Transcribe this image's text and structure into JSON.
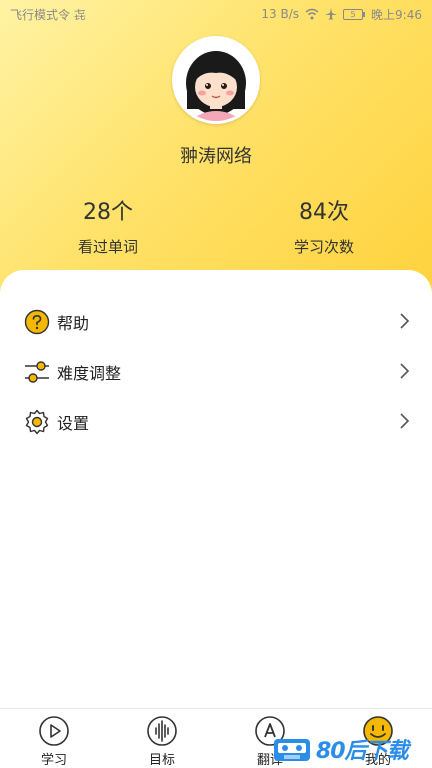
{
  "status_bar": {
    "left_text": "飞行模式令 㐂",
    "speed": "13 B/s",
    "time": "晚上9:46",
    "battery": "5"
  },
  "profile": {
    "username": "翀涛网络",
    "stats": [
      {
        "value": "28个",
        "label": "看过单词"
      },
      {
        "value": "84次",
        "label": "学习次数"
      }
    ]
  },
  "menu": [
    {
      "label": "帮助",
      "icon": "help-icon"
    },
    {
      "label": "难度调整",
      "icon": "sliders-icon"
    },
    {
      "label": "设置",
      "icon": "gear-icon"
    }
  ],
  "tabs": [
    {
      "label": "学习",
      "icon": "play-circle-icon"
    },
    {
      "label": "目标",
      "icon": "soundwave-icon"
    },
    {
      "label": "翻译",
      "icon": "translate-icon"
    },
    {
      "label": "我的",
      "icon": "smiley-icon"
    }
  ],
  "watermark": {
    "text": "80后下载"
  },
  "colors": {
    "accent": "#ffd23c",
    "icon_yellow": "#f5b800",
    "wm_blue": "#2a8ee8"
  }
}
